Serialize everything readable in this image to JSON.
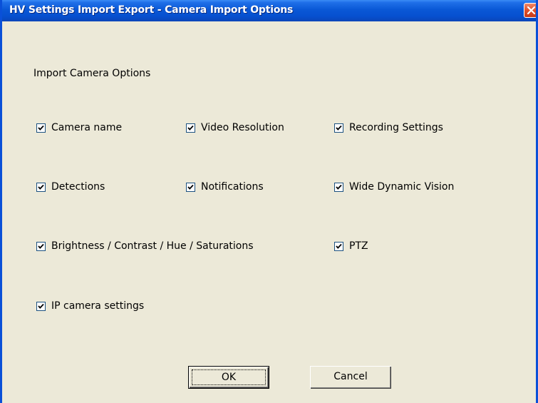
{
  "window": {
    "title": "HV Settings Import Export - Camera Import Options"
  },
  "section_label": "Import Camera Options",
  "options": [
    {
      "label": "Camera name",
      "checked": true
    },
    {
      "label": "Video Resolution",
      "checked": true
    },
    {
      "label": "Recording Settings",
      "checked": true
    },
    {
      "label": "Detections",
      "checked": true
    },
    {
      "label": "Notifications",
      "checked": true
    },
    {
      "label": "Wide Dynamic Vision",
      "checked": true
    },
    {
      "label": "Brightness / Contrast / Hue / Saturations",
      "checked": true
    },
    {
      "label": "PTZ",
      "checked": true
    },
    {
      "label": "IP camera settings",
      "checked": true
    }
  ],
  "buttons": {
    "ok_label": "OK",
    "cancel_label": "Cancel"
  },
  "colors": {
    "titlebar": "#0a58d6",
    "window_bg": "#ece9d8",
    "close_button": "#e0502a"
  },
  "icons": {
    "close": "close-x-icon",
    "checkmark": "checkmark-icon"
  }
}
